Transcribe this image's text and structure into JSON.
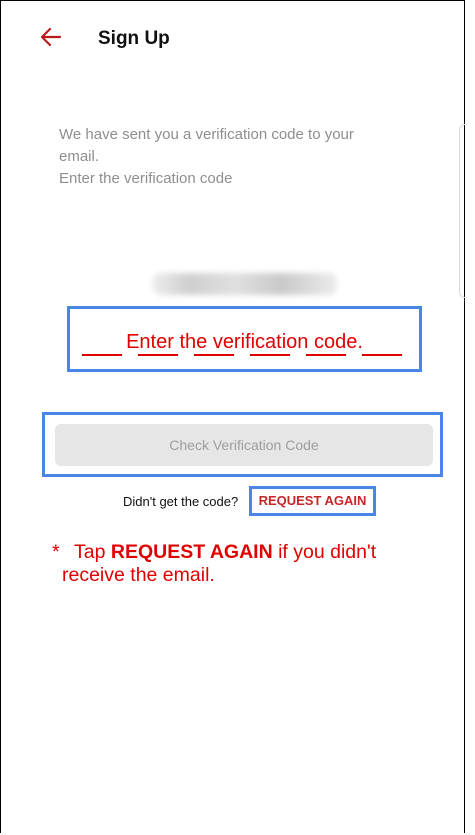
{
  "header": {
    "back_icon": "arrow-left-icon",
    "title": "Sign Up"
  },
  "info": {
    "line1": "We have sent you a verification code to your",
    "line2": "email.",
    "line3": "Enter the verification code"
  },
  "code_entry": {
    "annotation": "Enter the verification code.",
    "digit_count": 6
  },
  "buttons": {
    "check": "Check Verification Code"
  },
  "resend": {
    "prompt": "Didn't get the code?",
    "action": "REQUEST AGAIN"
  },
  "note": {
    "star": "*",
    "prefix": "Tap",
    "emph": "REQUEST AGAIN",
    "suffix": "if you didn't",
    "line2": "receive the email."
  },
  "colors": {
    "accent": "#c62828",
    "annotation": "#e00000",
    "highlight": "#4a86e8",
    "button_bg": "#e6e6e6"
  }
}
